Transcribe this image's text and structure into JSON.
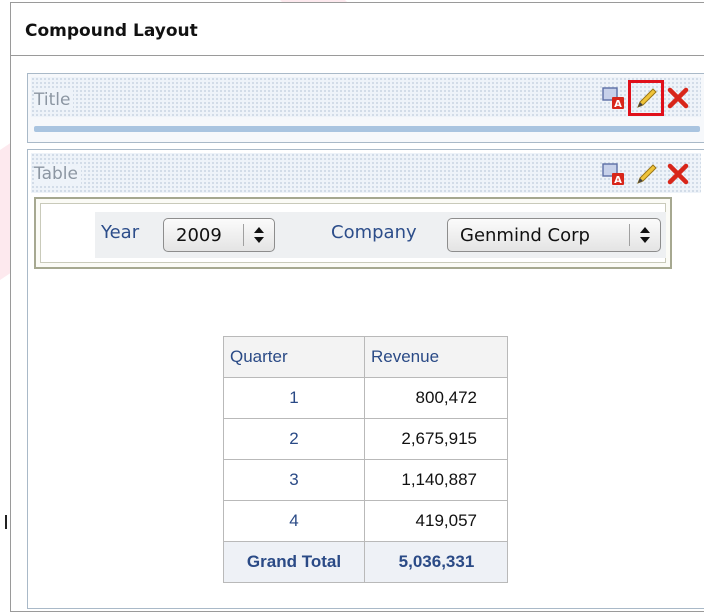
{
  "compound": {
    "title": "Compound Layout"
  },
  "title_view": {
    "label": "Title",
    "toolbar": {
      "format_icon": "format-container-icon",
      "edit_icon": "pencil-edit-icon",
      "delete_icon": "delete-x-icon"
    },
    "highlighted": "edit"
  },
  "table_view": {
    "label": "Table",
    "toolbar": {
      "format_icon": "format-container-icon",
      "edit_icon": "pencil-edit-icon",
      "delete_icon": "delete-x-icon"
    }
  },
  "prompts": {
    "year": {
      "label": "Year",
      "value": "2009"
    },
    "company": {
      "label": "Company",
      "value": "Genmind Corp"
    }
  },
  "table": {
    "columns": [
      "Quarter",
      "Revenue"
    ],
    "rows": [
      {
        "quarter": "1",
        "revenue": "800,472"
      },
      {
        "quarter": "2",
        "revenue": "2,675,915"
      },
      {
        "quarter": "3",
        "revenue": "1,140,887"
      },
      {
        "quarter": "4",
        "revenue": "419,057"
      }
    ],
    "total": {
      "label": "Grand Total",
      "revenue": "5,036,331"
    }
  },
  "colors": {
    "highlight": "#e0101a",
    "label_blue": "#2a4a86",
    "delete_red": "#d8261a",
    "pencil_yellow": "#e8b830"
  }
}
